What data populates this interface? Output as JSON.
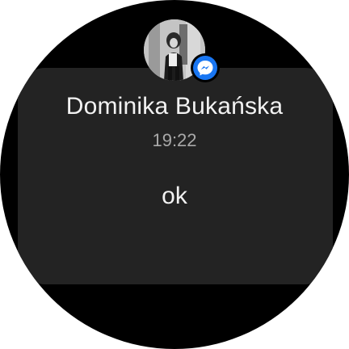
{
  "notification": {
    "app_icon": "messenger-icon",
    "avatar": "contact-avatar-photo",
    "sender_name": "Dominika Bukańska",
    "time": "19:22",
    "message": "ok"
  },
  "colors": {
    "watch_background": "#000000",
    "card_background": "#232323",
    "primary_text": "#f2f2f2",
    "secondary_text": "#a9a9a9",
    "messenger_badge": "#1976f2"
  }
}
